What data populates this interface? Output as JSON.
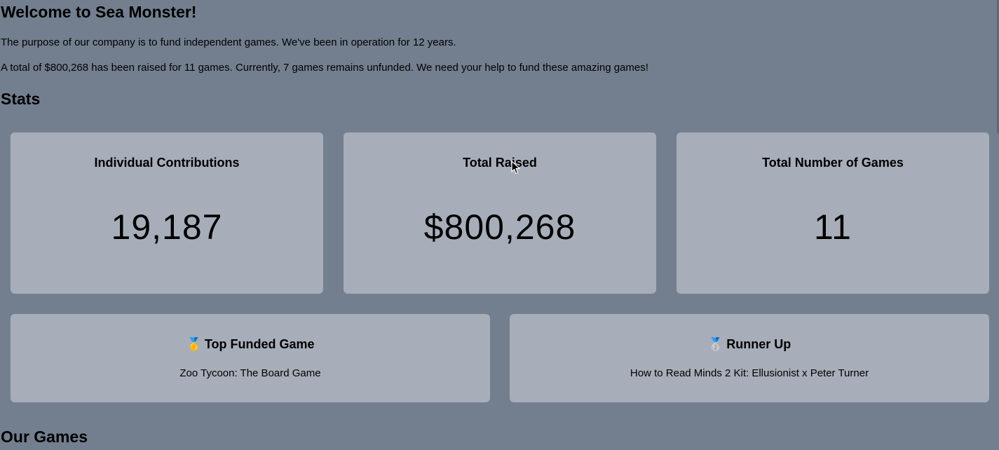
{
  "welcome": {
    "title": "Welcome to Sea Monster!",
    "purpose": "The purpose of our company is to fund independent games. We've been in operation for 12 years.",
    "summary": "A total of $800,268 has been raised for 11 games. Currently, 7 games remains unfunded. We need your help to fund these amazing games!"
  },
  "stats": {
    "heading": "Stats",
    "cards": [
      {
        "label": "Individual Contributions",
        "value": "19,187"
      },
      {
        "label": "Total Raised",
        "value": "$800,268"
      },
      {
        "label": "Total Number of Games",
        "value": "11"
      }
    ]
  },
  "funding": {
    "top": {
      "medal": "🥇",
      "icon_name": "gold-medal-icon",
      "label": "Top Funded Game",
      "game": "Zoo Tycoon: The Board Game"
    },
    "runner_up": {
      "medal": "🥈",
      "icon_name": "silver-medal-icon",
      "label": "Runner Up",
      "game": "How to Read Minds 2 Kit: Ellusionist x Peter Turner"
    }
  },
  "games": {
    "heading": "Our Games"
  },
  "colors": {
    "background": "#737f8f",
    "card": "#a7aeb9"
  }
}
